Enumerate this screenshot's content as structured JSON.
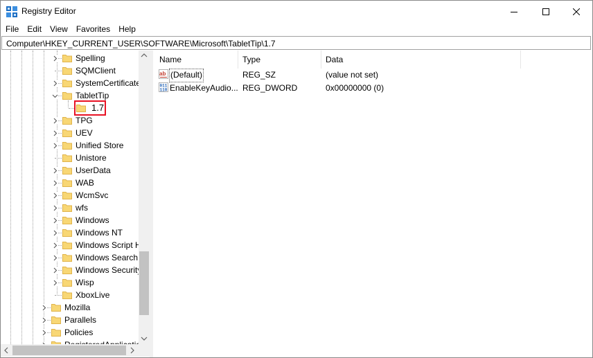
{
  "window": {
    "title": "Registry Editor"
  },
  "menu": [
    "File",
    "Edit",
    "View",
    "Favorites",
    "Help"
  ],
  "address": "Computer\\HKEY_CURRENT_USER\\SOFTWARE\\Microsoft\\TabletTip\\1.7",
  "tree": {
    "items": [
      {
        "label": "Spelling",
        "expander": "right"
      },
      {
        "label": "SQMClient",
        "expander": "none"
      },
      {
        "label": "SystemCertificate",
        "expander": "right"
      },
      {
        "label": "TabletTip",
        "expander": "down"
      },
      {
        "label": "1.7",
        "expander": "none",
        "selected": true
      },
      {
        "label": "TPG",
        "expander": "right"
      },
      {
        "label": "UEV",
        "expander": "right"
      },
      {
        "label": "Unified Store",
        "expander": "right"
      },
      {
        "label": "Unistore",
        "expander": "none"
      },
      {
        "label": "UserData",
        "expander": "right"
      },
      {
        "label": "WAB",
        "expander": "right"
      },
      {
        "label": "WcmSvc",
        "expander": "right"
      },
      {
        "label": "wfs",
        "expander": "right"
      },
      {
        "label": "Windows",
        "expander": "right"
      },
      {
        "label": "Windows NT",
        "expander": "right"
      },
      {
        "label": "Windows Script H",
        "expander": "right"
      },
      {
        "label": "Windows Search",
        "expander": "right"
      },
      {
        "label": "Windows Security",
        "expander": "right"
      },
      {
        "label": "Wisp",
        "expander": "right"
      },
      {
        "label": "XboxLive",
        "expander": "none"
      },
      {
        "label": "Mozilla",
        "expander": "right"
      },
      {
        "label": "Parallels",
        "expander": "right"
      },
      {
        "label": "Policies",
        "expander": "right"
      },
      {
        "label": "RegisteredApplicatio",
        "expander": "right"
      }
    ]
  },
  "list": {
    "columns": [
      "Name",
      "Type",
      "Data"
    ],
    "rows": [
      {
        "icon": "string-value-icon",
        "name": "(Default)",
        "type": "REG_SZ",
        "data": "(value not set)"
      },
      {
        "icon": "binary-value-icon",
        "name": "EnableKeyAudio...",
        "type": "REG_DWORD",
        "data": "0x00000000 (0)"
      }
    ]
  },
  "colors": {
    "highlight_border": "#e81123",
    "folder": "#f8d775",
    "folder_dark": "#e0b34a"
  }
}
